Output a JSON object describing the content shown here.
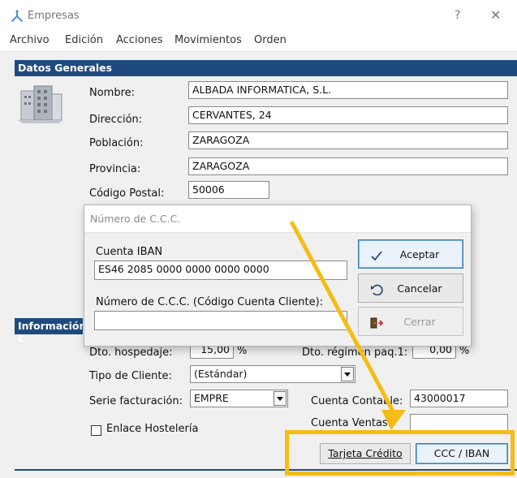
{
  "window": {
    "title": "Empresas",
    "help_glyph": "?",
    "close_glyph": "✕"
  },
  "menu": [
    "Archivo",
    "Edición",
    "Acciones",
    "Movimientos",
    "Orden"
  ],
  "datos_generales": {
    "header": "Datos Generales",
    "nombre_label": "Nombre:",
    "nombre_value": "ALBADA INFORMATICA, S.L.",
    "direccion_label": "Dirección:",
    "direccion_value": "CERVANTES, 24",
    "poblacion_label": "Población:",
    "poblacion_value": "ZARAGOZA",
    "provincia_label": "Provincia:",
    "provincia_value": "ZARAGOZA",
    "cp_label": "Código Postal:",
    "cp_value": "50006"
  },
  "informacion": {
    "header": "Información c",
    "dto_hospedaje_label": "Dto. hospedaje:",
    "dto_hospedaje_value": "15,00",
    "pct_symbol": "%",
    "dto_regimen_label": "Dto. régimen paq.1:",
    "dto_regimen_value": "0,00",
    "tipo_cliente_label": "Tipo de Cliente:",
    "tipo_cliente_value": "(Estándar)",
    "serie_label": "Serie facturación:",
    "serie_value": "EMPRE",
    "cuenta_contable_label": "Cuenta Contable:",
    "cuenta_contable_value": "43000017",
    "cuenta_ventas_label": "Cuenta Ventas:",
    "enlace_label": "Enlace Hostelería",
    "tarjeta_button": "Tarjeta Crédito",
    "ccc_button": "CCC / IBAN"
  },
  "dialog": {
    "title": "Número de C.C.C.",
    "iban_label": "Cuenta IBAN",
    "iban_value": "ES46 2085 0000 0000 0000 0000",
    "ccc_label": "Número de C.C.C. (Código Cuenta Cliente):",
    "ccc_value": "",
    "accept_label": "Aceptar",
    "cancel_label": "Cancelar",
    "close_label": "Cerrar"
  },
  "colors": {
    "section_header": "#1f4a80",
    "highlight": "#f5bc14"
  }
}
